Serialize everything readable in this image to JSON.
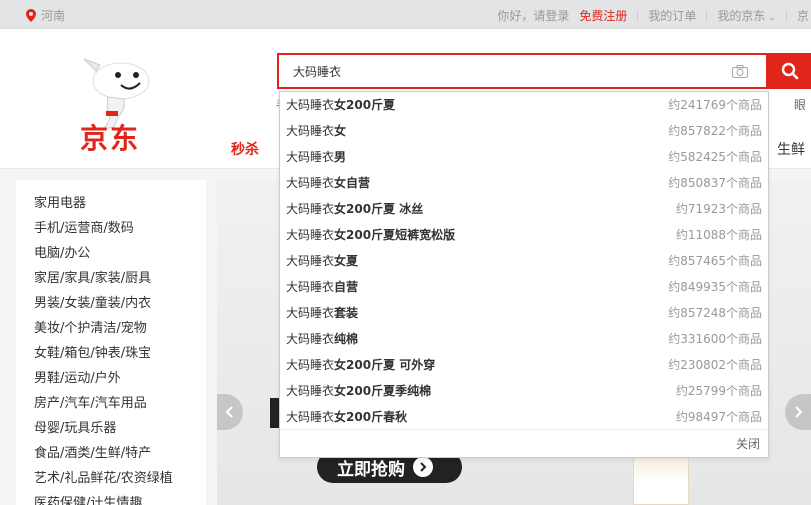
{
  "topbar": {
    "location": "河南",
    "greeting": "你好，请登录",
    "register": "免费注册",
    "my_orders": "我的订单",
    "my_jd": "我的京东",
    "extra": "京"
  },
  "header": {
    "logo_text": "京东",
    "search_value": "大码睡衣",
    "miaosha": "秒杀",
    "right_cut": "生鲜",
    "hint_left": "手",
    "hint_right": "眼"
  },
  "categories": [
    "家用电器",
    "手机/运营商/数码",
    "电脑/办公",
    "家居/家具/家装/厨具",
    "男装/女装/童装/内衣",
    "美妆/个护清洁/宠物",
    "女鞋/箱包/钟表/珠宝",
    "男鞋/运动/户外",
    "房产/汽车/汽车用品",
    "母婴/玩具乐器",
    "食品/酒类/生鲜/特产",
    "艺术/礼品鲜花/农资绿植",
    "医药保健/计生情趣"
  ],
  "suggestions": [
    {
      "prefix": "大码睡衣",
      "rest": "女200斤夏",
      "count": "约241769个商品"
    },
    {
      "prefix": "大码睡衣",
      "rest": "女",
      "count": "约857822个商品"
    },
    {
      "prefix": "大码睡衣",
      "rest": "男",
      "count": "约582425个商品"
    },
    {
      "prefix": "大码睡衣",
      "rest": "女自营",
      "count": "约850837个商品"
    },
    {
      "prefix": "大码睡衣",
      "rest": "女200斤夏 冰丝",
      "count": "约71923个商品"
    },
    {
      "prefix": "大码睡衣",
      "rest": "女200斤夏短裤宽松版",
      "count": "约11088个商品"
    },
    {
      "prefix": "大码睡衣",
      "rest": "女夏",
      "count": "约857465个商品"
    },
    {
      "prefix": "大码睡衣",
      "rest": "自营",
      "count": "约849935个商品"
    },
    {
      "prefix": "大码睡衣",
      "rest": "套装",
      "count": "约857248个商品"
    },
    {
      "prefix": "大码睡衣",
      "rest": "纯棉",
      "count": "约331600个商品"
    },
    {
      "prefix": "大码睡衣",
      "rest": "女200斤夏 可外穿",
      "count": "约230802个商品"
    },
    {
      "prefix": "大码睡衣",
      "rest": "女200斤夏季纯棉",
      "count": "约25799个商品"
    },
    {
      "prefix": "大码睡衣",
      "rest": "女200斤春秋",
      "count": "约98497个商品"
    }
  ],
  "suggest_close": "关闭",
  "banner": {
    "cta": "立即抢购"
  },
  "colors": {
    "brand_red": "#e1251b"
  }
}
